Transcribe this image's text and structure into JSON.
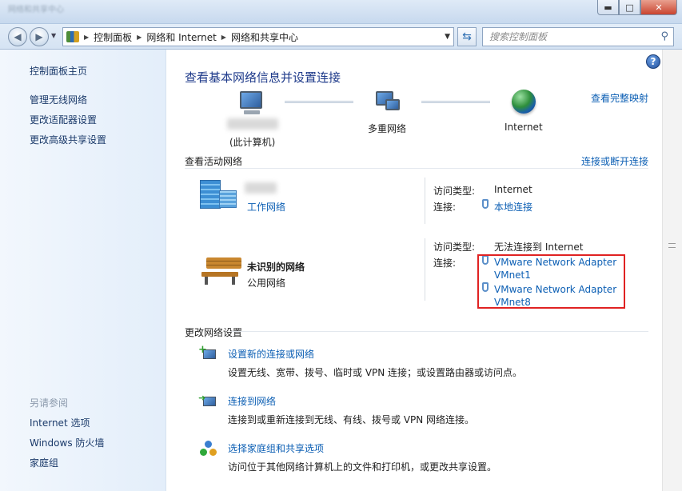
{
  "window": {
    "title": "网络和共享中心",
    "controls": {
      "minimize": "▬",
      "maximize": "□",
      "close": "✕"
    }
  },
  "address_bar": {
    "crumbs": [
      "控制面板",
      "网络和 Internet",
      "网络和共享中心"
    ],
    "search_placeholder": "搜索控制面板"
  },
  "sidebar": {
    "home": "控制面板主页",
    "items": [
      "管理无线网络",
      "更改适配器设置",
      "更改高级共享设置"
    ],
    "see_also_title": "另请参阅",
    "see_also": [
      "Internet 选项",
      "Windows 防火墙",
      "家庭组"
    ]
  },
  "main": {
    "heading": "查看基本网络信息并设置连接",
    "view_full_map": "查看完整映射",
    "map": {
      "computer_label": "(此计算机)",
      "network_label": "多重网络",
      "internet_label": "Internet"
    },
    "active_title": "查看活动网络",
    "connect_disconnect": "连接或断开连接",
    "networks": [
      {
        "type_link": "工作网络",
        "access_label": "访问类型:",
        "access_value": "Internet",
        "conn_label": "连接:",
        "connections": [
          "本地连接"
        ]
      },
      {
        "name": "未识别的网络",
        "type_text": "公用网络",
        "access_label": "访问类型:",
        "access_value": "无法连接到 Internet",
        "conn_label": "连接:",
        "connections": [
          "VMware Network Adapter VMnet1",
          "VMware Network Adapter VMnet8"
        ]
      }
    ],
    "settings_title": "更改网络设置",
    "tasks": [
      {
        "title": "设置新的连接或网络",
        "desc": "设置无线、宽带、拨号、临时或 VPN 连接；或设置路由器或访问点。"
      },
      {
        "title": "连接到网络",
        "desc": "连接到或重新连接到无线、有线、拨号或 VPN 网络连接。"
      },
      {
        "title": "选择家庭组和共享选项",
        "desc": "访问位于其他网络计算机上的文件和打印机，或更改共享设置。"
      }
    ]
  },
  "colors": {
    "link": "#0c5fb4",
    "heading": "#1e3a8a",
    "highlight": "#e02222"
  }
}
